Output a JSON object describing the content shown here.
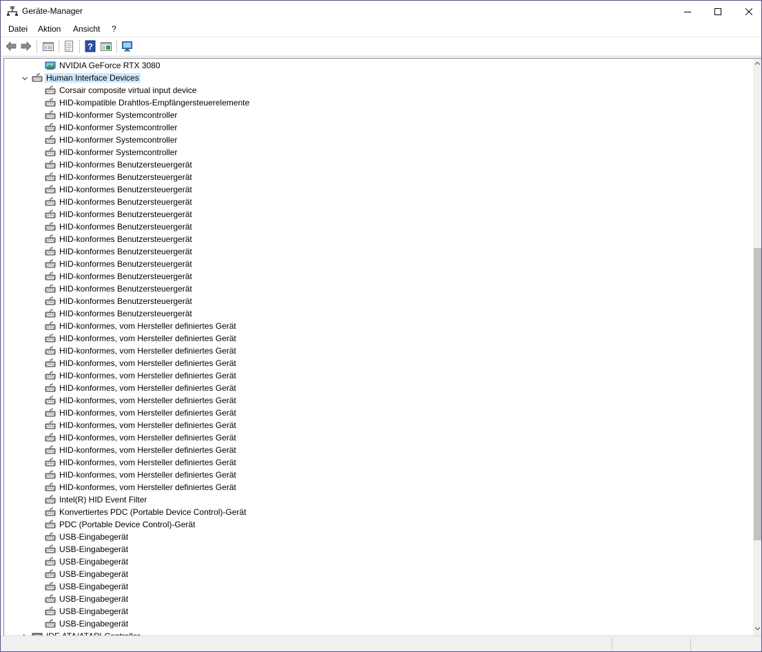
{
  "window": {
    "title": "Geräte-Manager",
    "title_icon": "device-manager-icon"
  },
  "menu": [
    "Datei",
    "Aktion",
    "Ansicht",
    "?"
  ],
  "toolbar": {
    "buttons": [
      "back-arrow-icon",
      "forward-arrow-icon",
      "show-hide-console-tree-icon",
      "properties-icon",
      "help-icon",
      "update-driver-icon",
      "scan-hardware-icon"
    ]
  },
  "tree": {
    "rows": [
      {
        "label": "NVIDIA GeForce RTX 3080",
        "icon": "display-adapter-icon",
        "level": 1
      },
      {
        "label": "Human Interface Devices",
        "icon": "hid-category-icon",
        "level": 0,
        "expanded": true,
        "selected": true
      },
      {
        "label": "Corsair composite virtual input device",
        "icon": "hid-device-icon",
        "level": 1
      },
      {
        "label": "HID-kompatible Drahtlos-Empfängersteuerelemente",
        "icon": "hid-device-icon",
        "level": 1
      },
      {
        "label": "HID-konformer Systemcontroller",
        "icon": "hid-device-icon",
        "level": 1
      },
      {
        "label": "HID-konformer Systemcontroller",
        "icon": "hid-device-icon",
        "level": 1
      },
      {
        "label": "HID-konformer Systemcontroller",
        "icon": "hid-device-icon",
        "level": 1
      },
      {
        "label": "HID-konformer Systemcontroller",
        "icon": "hid-device-icon",
        "level": 1
      },
      {
        "label": "HID-konformes Benutzersteuergerät",
        "icon": "hid-device-icon",
        "level": 1
      },
      {
        "label": "HID-konformes Benutzersteuergerät",
        "icon": "hid-device-icon",
        "level": 1
      },
      {
        "label": "HID-konformes Benutzersteuergerät",
        "icon": "hid-device-icon",
        "level": 1
      },
      {
        "label": "HID-konformes Benutzersteuergerät",
        "icon": "hid-device-icon",
        "level": 1
      },
      {
        "label": "HID-konformes Benutzersteuergerät",
        "icon": "hid-device-icon",
        "level": 1
      },
      {
        "label": "HID-konformes Benutzersteuergerät",
        "icon": "hid-device-icon",
        "level": 1
      },
      {
        "label": "HID-konformes Benutzersteuergerät",
        "icon": "hid-device-icon",
        "level": 1
      },
      {
        "label": "HID-konformes Benutzersteuergerät",
        "icon": "hid-device-icon",
        "level": 1
      },
      {
        "label": "HID-konformes Benutzersteuergerät",
        "icon": "hid-device-icon",
        "level": 1
      },
      {
        "label": "HID-konformes Benutzersteuergerät",
        "icon": "hid-device-icon",
        "level": 1
      },
      {
        "label": "HID-konformes Benutzersteuergerät",
        "icon": "hid-device-icon",
        "level": 1
      },
      {
        "label": "HID-konformes Benutzersteuergerät",
        "icon": "hid-device-icon",
        "level": 1
      },
      {
        "label": "HID-konformes Benutzersteuergerät",
        "icon": "hid-device-icon",
        "level": 1
      },
      {
        "label": "HID-konformes, vom Hersteller definiertes Gerät",
        "icon": "hid-device-icon",
        "level": 1
      },
      {
        "label": "HID-konformes, vom Hersteller definiertes Gerät",
        "icon": "hid-device-icon",
        "level": 1
      },
      {
        "label": "HID-konformes, vom Hersteller definiertes Gerät",
        "icon": "hid-device-icon",
        "level": 1
      },
      {
        "label": "HID-konformes, vom Hersteller definiertes Gerät",
        "icon": "hid-device-icon",
        "level": 1
      },
      {
        "label": "HID-konformes, vom Hersteller definiertes Gerät",
        "icon": "hid-device-icon",
        "level": 1
      },
      {
        "label": "HID-konformes, vom Hersteller definiertes Gerät",
        "icon": "hid-device-icon",
        "level": 1
      },
      {
        "label": "HID-konformes, vom Hersteller definiertes Gerät",
        "icon": "hid-device-icon",
        "level": 1
      },
      {
        "label": "HID-konformes, vom Hersteller definiertes Gerät",
        "icon": "hid-device-icon",
        "level": 1
      },
      {
        "label": "HID-konformes, vom Hersteller definiertes Gerät",
        "icon": "hid-device-icon",
        "level": 1
      },
      {
        "label": "HID-konformes, vom Hersteller definiertes Gerät",
        "icon": "hid-device-icon",
        "level": 1
      },
      {
        "label": "HID-konformes, vom Hersteller definiertes Gerät",
        "icon": "hid-device-icon",
        "level": 1
      },
      {
        "label": "HID-konformes, vom Hersteller definiertes Gerät",
        "icon": "hid-device-icon",
        "level": 1
      },
      {
        "label": "HID-konformes, vom Hersteller definiertes Gerät",
        "icon": "hid-device-icon",
        "level": 1
      },
      {
        "label": "HID-konformes, vom Hersteller definiertes Gerät",
        "icon": "hid-device-icon",
        "level": 1
      },
      {
        "label": "Intel(R) HID Event Filter",
        "icon": "hid-device-icon",
        "level": 1
      },
      {
        "label": "Konvertiertes PDC (Portable Device Control)-Gerät",
        "icon": "hid-device-icon",
        "level": 1
      },
      {
        "label": "PDC (Portable Device Control)-Gerät",
        "icon": "hid-device-icon",
        "level": 1
      },
      {
        "label": "USB-Eingabegerät",
        "icon": "hid-device-icon",
        "level": 1
      },
      {
        "label": "USB-Eingabegerät",
        "icon": "hid-device-icon",
        "level": 1
      },
      {
        "label": "USB-Eingabegerät",
        "icon": "hid-device-icon",
        "level": 1
      },
      {
        "label": "USB-Eingabegerät",
        "icon": "hid-device-icon",
        "level": 1
      },
      {
        "label": "USB-Eingabegerät",
        "icon": "hid-device-icon",
        "level": 1
      },
      {
        "label": "USB-Eingabegerät",
        "icon": "hid-device-icon",
        "level": 1
      },
      {
        "label": "USB-Eingabegerät",
        "icon": "hid-device-icon",
        "level": 1
      },
      {
        "label": "USB-Eingabegerät",
        "icon": "hid-device-icon",
        "level": 1
      },
      {
        "label": "IDE ATA/ATAPI-Controller",
        "icon": "ide-controller-icon",
        "level": 0,
        "expanded": false,
        "partial": true
      }
    ]
  },
  "colors": {
    "selection": "#cce8ff",
    "window_border": "#5a4a8a",
    "statusbar": "#f0f0f0"
  }
}
